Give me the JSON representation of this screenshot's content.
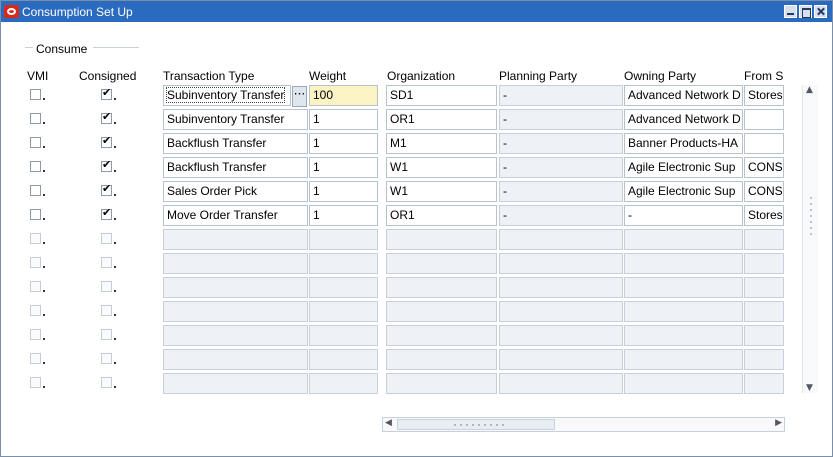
{
  "window": {
    "title": "Consumption Set Up"
  },
  "group": {
    "label": "Consume"
  },
  "columns": {
    "vmi": "VMI",
    "consigned": "Consigned",
    "transaction_type": "Transaction Type",
    "weight": "Weight",
    "organization": "Organization",
    "planning_party": "Planning Party",
    "owning_party": "Owning Party",
    "from": "From S"
  },
  "lov_glyph": "···",
  "rows": [
    {
      "vmi": false,
      "consigned": true,
      "transaction_type": "Subinventory Transfer",
      "weight": "100",
      "organization": "SD1",
      "planning_party": "-",
      "owning_party": "Advanced Network D",
      "from": "Stores"
    },
    {
      "vmi": false,
      "consigned": true,
      "transaction_type": "Subinventory Transfer",
      "weight": "1",
      "organization": "OR1",
      "planning_party": "-",
      "owning_party": "Advanced Network D",
      "from": ""
    },
    {
      "vmi": false,
      "consigned": true,
      "transaction_type": "Backflush Transfer",
      "weight": "1",
      "organization": "M1",
      "planning_party": "-",
      "owning_party": "Banner Products-HA",
      "from": ""
    },
    {
      "vmi": false,
      "consigned": true,
      "transaction_type": "Backflush Transfer",
      "weight": "1",
      "organization": "W1",
      "planning_party": "-",
      "owning_party": "Agile Electronic Sup",
      "from": "CONS"
    },
    {
      "vmi": false,
      "consigned": true,
      "transaction_type": "Sales Order Pick",
      "weight": "1",
      "organization": "W1",
      "planning_party": "-",
      "owning_party": "Agile Electronic Sup",
      "from": "CONS"
    },
    {
      "vmi": false,
      "consigned": true,
      "transaction_type": "Move Order Transfer",
      "weight": "1",
      "organization": "OR1",
      "planning_party": "-",
      "owning_party": "-",
      "from": "Stores"
    }
  ]
}
